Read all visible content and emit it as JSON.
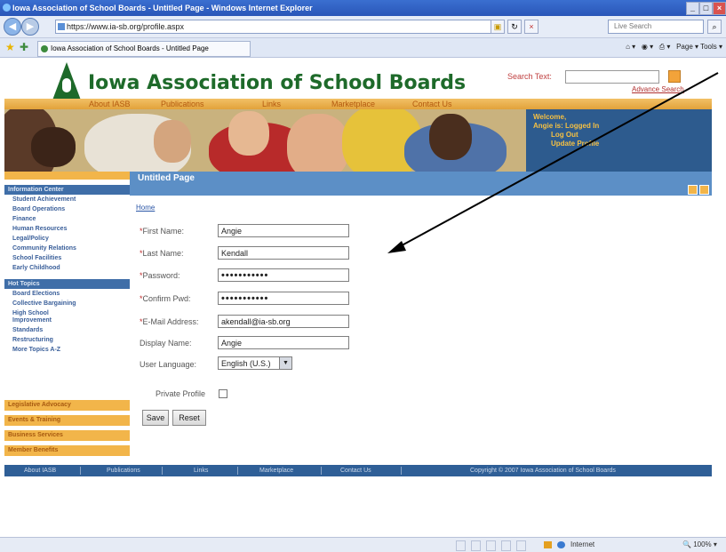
{
  "browser": {
    "window_title": "Iowa Association of School Boards - Untitled Page - Windows Internet Explorer",
    "address": "https://www.ia-sb.org/profile.aspx",
    "search_placeholder": "Live Search",
    "tab_title": "Iowa Association of School Boards - Untitled Page",
    "commands": "Page ▾   Tools ▾",
    "status_zone": "Internet",
    "zoom": "100%"
  },
  "site": {
    "title": "Iowa Association of School Boards",
    "search_label": "Search Text:",
    "advance_search": "Advance Search",
    "top_nav": [
      "About IASB",
      "Publications",
      "Links",
      "Marketplace",
      "Contact Us"
    ],
    "welcome": {
      "line1": "Welcome,",
      "line2": "Angie is: Logged In",
      "logout": "Log Out",
      "update_profile": "Update Profile"
    }
  },
  "sidebar": {
    "section1_title": "Information Center",
    "section1_items": [
      "Student Achievement",
      "Board Operations",
      "Finance",
      "Human Resources",
      "Legal/Policy",
      "Community Relations",
      "School Facilities",
      "Early Childhood"
    ],
    "section2_title": "Hot Topics",
    "section2_items": [
      "Board Elections",
      "Collective Bargaining",
      "High School",
      "Improvement",
      "Standards",
      "Restructuring",
      "More Topics A-Z"
    ],
    "bottom_items": [
      "Legislative Advocacy",
      "Events & Training",
      "Business Services",
      "Member Benefits"
    ]
  },
  "main": {
    "page_title": "Untitled Page",
    "breadcrumb": "Home",
    "form": {
      "first_name_label": "First Name:",
      "first_name": "Angie",
      "last_name_label": "Last Name:",
      "last_name": "Kendall",
      "password_label": "Password:",
      "password": "•••••••••••",
      "confirm_label": "Confirm Pwd:",
      "confirm": "•••••••••••",
      "email_label": "E-Mail Address:",
      "email": "akendall@ia-sb.org",
      "display_label": "Display Name:",
      "display_name": "Angie",
      "language_label": "User Language:",
      "language": "English (U.S.)",
      "private_label": "Private Profile",
      "save": "Save",
      "reset": "Reset"
    }
  },
  "footer": {
    "links": [
      "About IASB",
      "Publications",
      "Links",
      "Marketplace",
      "Contact Us"
    ],
    "copyright": "Copyright © 2007 Iowa Association of School Boards"
  },
  "colors": {
    "brand_green": "#1e6a2a",
    "nav_orange": "#f2b54a",
    "header_blue": "#5c8fc6",
    "footer_blue": "#2f5f97"
  }
}
